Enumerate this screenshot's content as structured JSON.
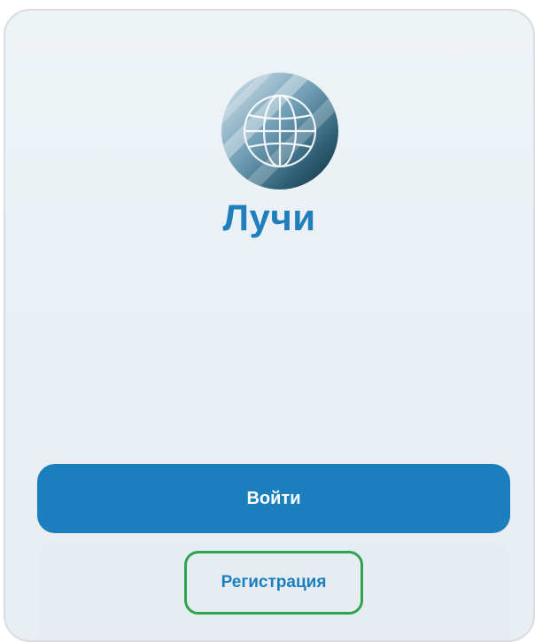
{
  "app": {
    "title": "Лучи",
    "logo_icon": "globe-logo-icon"
  },
  "actions": {
    "login_label": "Войти",
    "register_label": "Регистрация"
  },
  "colors": {
    "accent": "#1a7fbc",
    "title": "#1f7fbd",
    "focus_outline": "#2ea44f",
    "background": "#eef3f6"
  }
}
